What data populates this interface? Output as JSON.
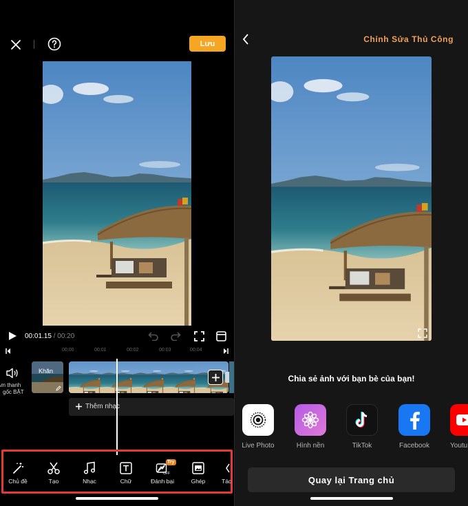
{
  "left": {
    "save_label": "Lưu",
    "time_current": "00:01.15",
    "time_separator": " / ",
    "time_total": "00:20",
    "ruler_ticks": [
      "00:00",
      "00:01",
      "00:02",
      "00:03",
      "00:04"
    ],
    "audio_label_line1": "Âm thanh",
    "audio_label_line2": "gốc BẬT",
    "cover_label": "Khăn",
    "add_music_label": "Thêm nhạc",
    "toolbar": [
      {
        "label": "Chủ đề",
        "icon": "magic-wand-icon"
      },
      {
        "label": "Tạo",
        "icon": "scissors-icon"
      },
      {
        "label": "Nhạc",
        "icon": "music-note-icon"
      },
      {
        "label": "Chữ",
        "icon": "text-icon"
      },
      {
        "label": "Đánh bại",
        "icon": "beat-icon",
        "badge": "Try",
        "sub": "OFF"
      },
      {
        "label": "Ghép",
        "icon": "image-overlay-icon"
      },
      {
        "label": "Tác",
        "icon": "effects-icon"
      }
    ],
    "highlight_color": "#e53935",
    "accent_color": "#f5a623"
  },
  "right": {
    "title": "Chỉnh Sửa Thủ Công",
    "share_heading": "Chia sẻ ảnh với bạn bè của bạn!",
    "share_options": [
      {
        "label": "Live Photo",
        "icon": "live-photo-icon"
      },
      {
        "label": "Hình nền",
        "icon": "wallpaper-flower-icon"
      },
      {
        "label": "TikTok",
        "icon": "tiktok-icon"
      },
      {
        "label": "Facebook",
        "icon": "facebook-icon"
      },
      {
        "label": "Youtu",
        "icon": "youtube-icon"
      }
    ],
    "home_button_label": "Quay lại Trang chủ",
    "title_color": "#f0a15a"
  }
}
